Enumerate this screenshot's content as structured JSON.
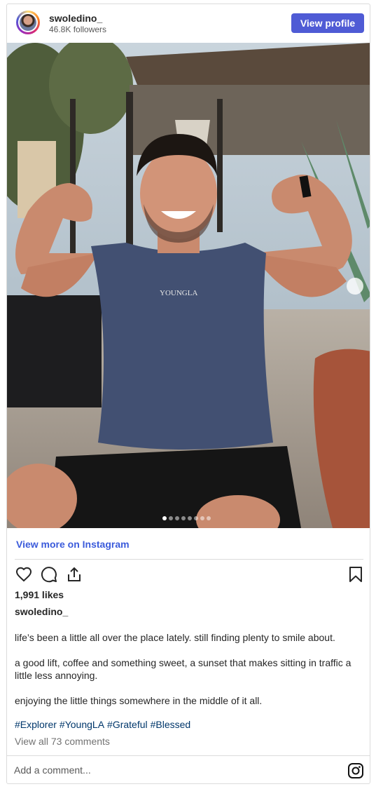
{
  "header": {
    "username": "swoledino_",
    "followers": "46.8K followers",
    "view_profile_label": "View profile"
  },
  "photo": {
    "shirt_text": "YOUNGLA",
    "carousel_dots": 8,
    "active_dot": 1
  },
  "links": {
    "view_more": "View more on Instagram"
  },
  "post": {
    "likes": "1,991 likes",
    "caption_user": "swoledino_",
    "caption_paragraphs": [
      "life’s been a little all over the place lately. still finding plenty to smile about.",
      "a good lift, coffee and something sweet, a sunset that makes sitting in traffic a little less annoying.",
      "enjoying the little things somewhere in the middle of it all."
    ],
    "hashtags": [
      "#Explorer",
      "#YoungLA",
      "#Grateful",
      "#Blessed"
    ],
    "view_comments": "View all 73 comments"
  },
  "comment": {
    "placeholder": "Add a comment..."
  },
  "colors": {
    "button_blue": "#4f5bd5",
    "link_blue": "#3b5bdb",
    "hashtag_blue": "#00376b",
    "border": "#dbdbdb"
  },
  "icons": [
    "heart-icon",
    "comment-icon",
    "share-icon",
    "bookmark-icon",
    "instagram-icon",
    "chevron-right-icon"
  ]
}
